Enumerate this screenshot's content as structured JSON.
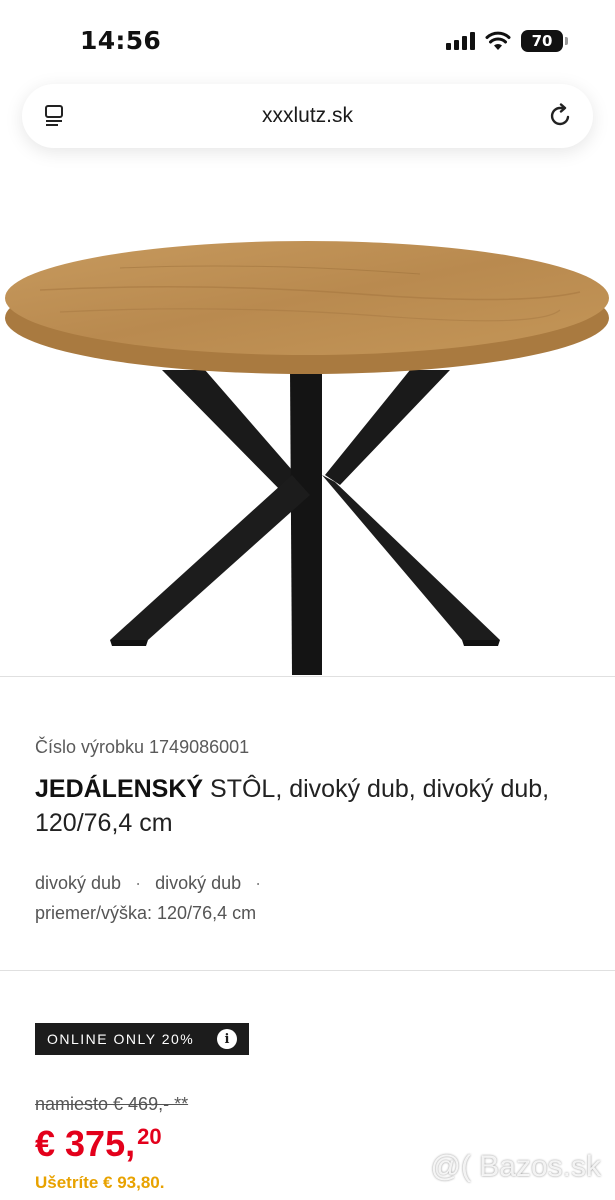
{
  "status_bar": {
    "time": "14:56",
    "battery": "70",
    "icons": [
      "signal-icon",
      "wifi-icon",
      "battery-icon"
    ]
  },
  "browser": {
    "url": "xxxlutz.sk",
    "icons": [
      "tabs-icon",
      "reload-icon"
    ]
  },
  "product": {
    "sku_label": "Číslo výrobku 1749086001",
    "title_bold": "JEDÁLENSKÝ",
    "title_rest": " STÔL, divoký dub, divoký dub, 120/76,4 cm",
    "attributes": [
      "divoký dub",
      "divoký dub",
      "priemer/výška: 120/76,4 cm"
    ],
    "separator": "·"
  },
  "promo": {
    "badge": "ONLINE ONLY 20%",
    "info_glyph": "i"
  },
  "pricing": {
    "old_price": "namiesto € 469,- **",
    "new_price_main": "€ 375,",
    "new_price_cents": "20",
    "savings": "Ušetríte € 93,80."
  },
  "watermark": "@( Bazos.sk",
  "colors": {
    "price_red": "#e3001b",
    "savings_orange": "#e8a200",
    "badge_black": "#1c1c1c"
  }
}
